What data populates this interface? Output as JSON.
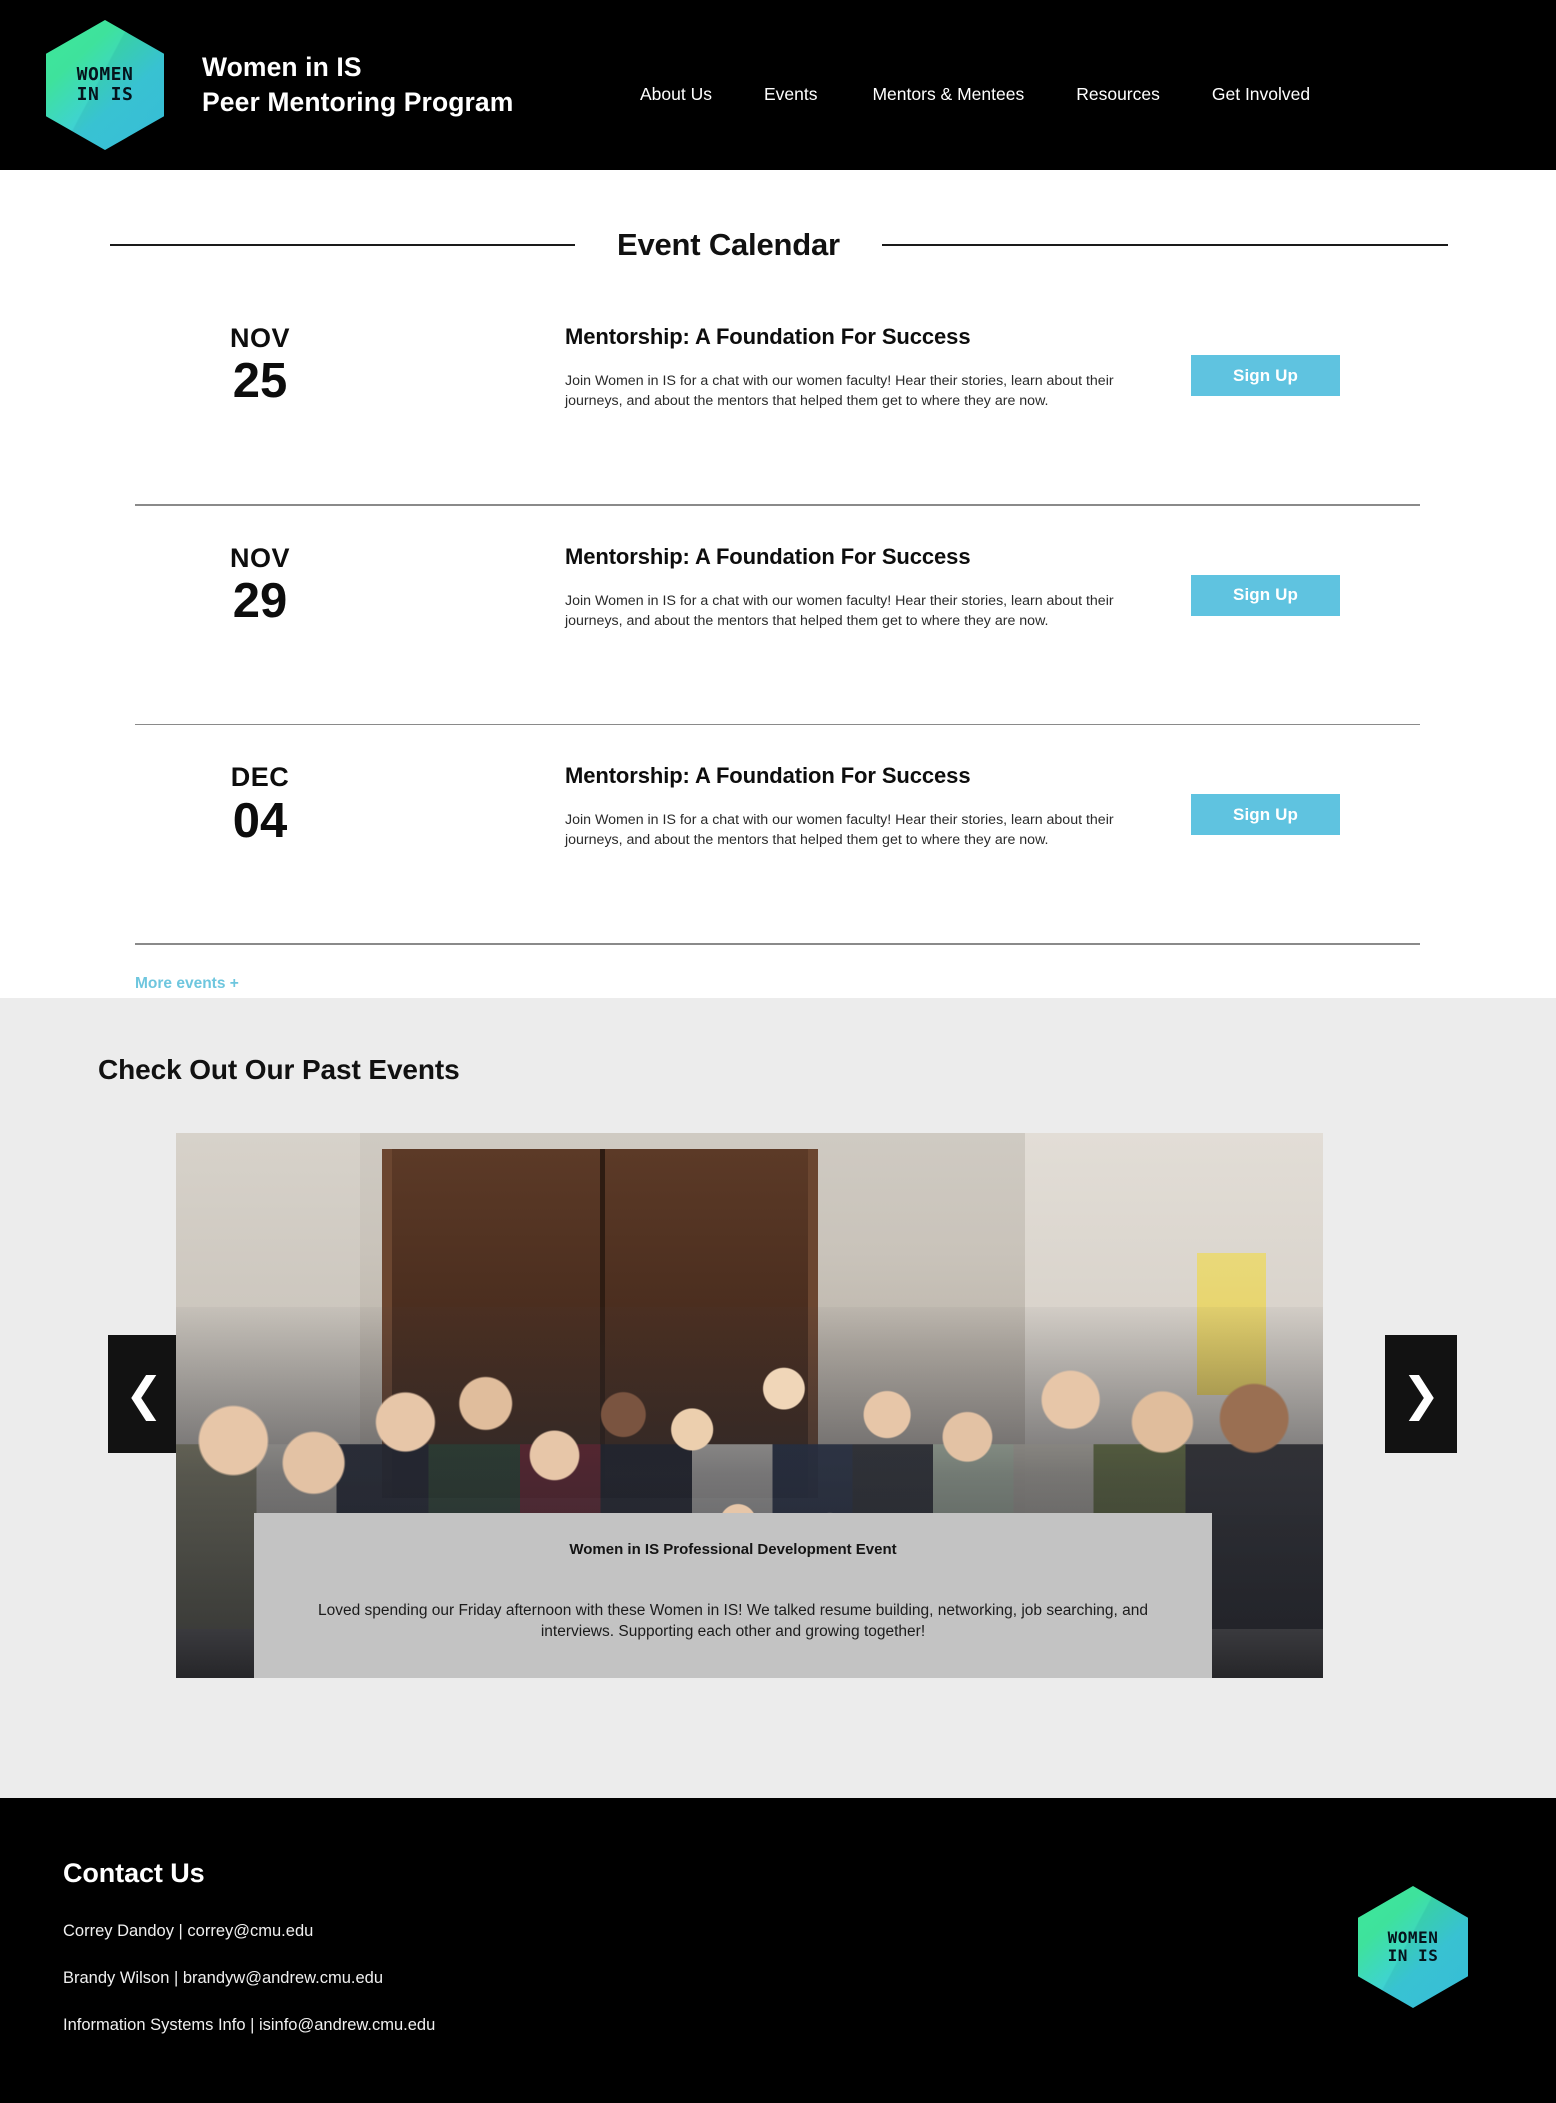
{
  "header": {
    "logo": {
      "line1": "WOMEN",
      "line2": "IN IS",
      "icon": "hexagon-logo",
      "gradient_from": "#3ee89a",
      "gradient_to": "#3ecbe6"
    },
    "brand_title": "Women in IS\nPeer Mentoring Program",
    "nav": [
      {
        "label": "About Us"
      },
      {
        "label": "Events"
      },
      {
        "label": "Mentors & Mentees"
      },
      {
        "label": "Resources"
      },
      {
        "label": "Get Involved"
      }
    ],
    "background": "#000000"
  },
  "calendar": {
    "title": "Event Calendar",
    "events": [
      {
        "month": "NOV",
        "day": "25",
        "title": "Mentorship: A Foundation For Success",
        "description": "Join Women in IS for a chat with our women faculty! Hear their stories, learn about their journeys, and about the mentors that helped them get to where they are now.",
        "button": "Sign Up"
      },
      {
        "month": "NOV",
        "day": "29",
        "title": "Mentorship: A Foundation For Success",
        "description": "Join Women in IS for a chat with our women faculty! Hear their stories, learn about their journeys, and about the mentors that helped them get to where they are now.",
        "button": "Sign Up"
      },
      {
        "month": "DEC",
        "day": "04",
        "title": "Mentorship: A Foundation For Success",
        "description": "Join Women in IS for a chat with our women faculty! Hear their stories, learn about their journeys, and about the mentors that helped them get to where they are now.",
        "button": "Sign Up"
      }
    ],
    "more_events_label": "More events +",
    "accent_color": "#5fc3e0",
    "link_color": "#6ec6de"
  },
  "past_events": {
    "title": "Check Out Our Past Events",
    "background": "#ececec",
    "carousel": {
      "prev_icon": "❮",
      "next_icon": "❯",
      "slide": {
        "image_alt": "Group photo of Women in IS members wearing masks in a room with wooden doors",
        "caption_title": "Women in IS Professional Development Event",
        "caption_text": "Loved spending our Friday afternoon with these Women in IS! We talked resume building, networking, job searching, and interviews. Supporting each other and growing together!"
      }
    }
  },
  "footer": {
    "title": "Contact Us",
    "contacts": [
      {
        "line": "Correy Dandoy | correy@cmu.edu"
      },
      {
        "line": "Brandy Wilson | brandyw@andrew.cmu.edu"
      },
      {
        "line": "Information Systems Info | isinfo@andrew.cmu.edu"
      }
    ],
    "logo": {
      "line1": "WOMEN",
      "line2": "IN IS"
    },
    "background": "#000000"
  }
}
